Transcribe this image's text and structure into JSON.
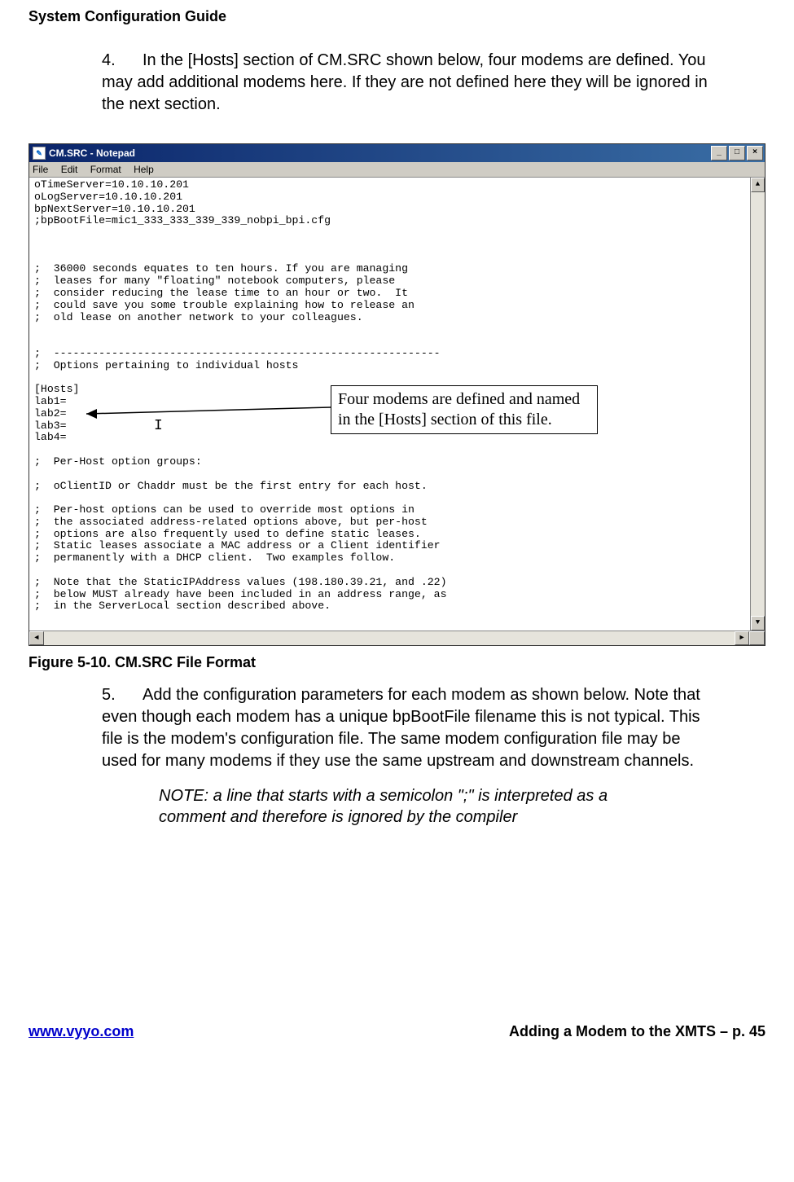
{
  "doc": {
    "header": "System Configuration Guide",
    "step4": {
      "num": "4.",
      "text": "In the [Hosts] section of CM.SRC shown below, four modems are defined. You may add additional modems here. If they are not defined here they will be ignored in the next section."
    },
    "step5": {
      "num": "5.",
      "text": "Add the configuration parameters for each modem as shown below. Note that even though each modem has a unique bpBootFile filename this is not typical.   This file is the modem's configuration file. The same modem configuration file may be used for many modems if they use the same upstream and downstream channels."
    },
    "note": "NOTE: a line that starts with a semicolon \";\" is interpreted as a comment and therefore is ignored by the compiler",
    "figCaption": "Figure 5-10. CM.SRC File Format",
    "callout": "Four modems are defined and named in the [Hosts] section of this file."
  },
  "footer": {
    "url": "www.vyyo.com",
    "right": "Adding a Modem to the XMTS – p. 45"
  },
  "notepad": {
    "title": "CM.SRC - Notepad",
    "menu": {
      "file": "File",
      "edit": "Edit",
      "format": "Format",
      "help": "Help"
    },
    "winbtns": {
      "min": "_",
      "max": "□",
      "close": "×"
    },
    "content": "oTimeServer=10.10.10.201\noLogServer=10.10.10.201\nbpNextServer=10.10.10.201\n;bpBootFile=mic1_333_333_339_339_nobpi_bpi.cfg\n\n\n\n;  36000 seconds equates to ten hours. If you are managing\n;  leases for many \"floating\" notebook computers, please\n;  consider reducing the lease time to an hour or two.  It\n;  could save you some trouble explaining how to release an\n;  old lease on another network to your colleagues.\n\n\n;  ------------------------------------------------------------\n;  Options pertaining to individual hosts\n\n[Hosts]\nlab1=\nlab2=\nlab3=\nlab4=\n\n;  Per-Host option groups:\n\n;  oClientID or Chaddr must be the first entry for each host.\n\n;  Per-host options can be used to override most options in\n;  the associated address-related options above, but per-host\n;  options are also frequently used to define static leases.\n;  Static leases associate a MAC address or a Client identifier\n;  permanently with a DHCP client.  Two examples follow.\n\n;  Note that the StaticIPAddress values (198.180.39.21, and .22)\n;  below MUST already have been included in an address range, as\n;  in the ServerLocal section described above."
  }
}
